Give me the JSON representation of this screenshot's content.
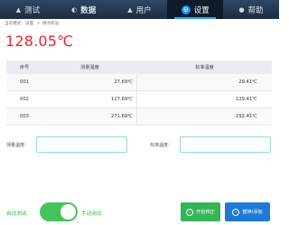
{
  "nav": {
    "items": [
      {
        "label": "测试",
        "icon": "person-icon"
      },
      {
        "label": "数据",
        "icon": "chart-icon"
      },
      {
        "label": "用户",
        "icon": "user-icon"
      },
      {
        "label": "设置",
        "icon": "gear-icon",
        "active": true
      },
      {
        "label": "帮助",
        "icon": "help-icon"
      }
    ]
  },
  "breadcrumb": {
    "prefix": "当前模式：",
    "level1": "设置",
    "separator": ">",
    "level2": "精点校准"
  },
  "reading": "128.05℃",
  "table": {
    "headers": [
      "序号",
      "测量温度",
      "标准温度"
    ],
    "rows": [
      [
        "001",
        "27.69℃",
        "29.41℃"
      ],
      [
        "002",
        "127.69℃",
        "129.41℃"
      ],
      [
        "003",
        "271.69℃",
        "292.41℃"
      ]
    ]
  },
  "fields": {
    "measured_label": "测量温度：",
    "measured_value": "",
    "standard_label": "标准温度：",
    "standard_value": ""
  },
  "mode": {
    "auto_label": "自动测试",
    "manual_label": "手动测试",
    "toggle_on": true
  },
  "buttons": {
    "start": "开始校正",
    "replace": "替换/添加"
  },
  "colors": {
    "nav_bg": "#1c2d44",
    "accent": "#1f79d7",
    "reading": "#e8262c",
    "green": "#39b54a"
  }
}
